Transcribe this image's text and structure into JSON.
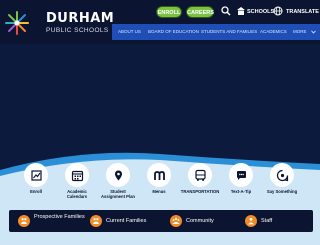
{
  "brand": {
    "name": "DURHAM",
    "subtitle": "PUBLIC SCHOOLS"
  },
  "utility": {
    "enroll_label": "ENROLL",
    "careers_label": "CAREERS",
    "schools_label": "SCHOOLS",
    "translate_label": "TRANSLATE"
  },
  "nav": {
    "items": [
      "ABOUT US",
      "BOARD OF EDUCATION",
      "STUDENTS AND FAMILIES",
      "ACADEMICS",
      "MORE"
    ]
  },
  "quick_links": [
    {
      "label": "Enroll",
      "icon": "enroll-icon"
    },
    {
      "label": "Academic Calendars",
      "icon": "calendar-icon"
    },
    {
      "label": "Student Assignment Plan",
      "icon": "map-pin-icon"
    },
    {
      "label": "Menus",
      "icon": "menus-icon"
    },
    {
      "label": "TRANSPORTATION",
      "icon": "bus-icon"
    },
    {
      "label": "Text-A-Tip",
      "icon": "chat-icon"
    },
    {
      "label": "Say Something",
      "icon": "megaphone-icon"
    }
  ],
  "audiences": [
    {
      "label": "Prospective Families",
      "icon": "family-icon"
    },
    {
      "label": "Current Families",
      "icon": "family-icon"
    },
    {
      "label": "Community",
      "icon": "community-icon"
    },
    {
      "label": "Staff",
      "icon": "staff-icon"
    }
  ],
  "colors": {
    "navy": "#0b1430",
    "hero": "#0c1a3e",
    "nav_blue": "#1e4eb6",
    "wave_blue": "#2a8fd6",
    "light_band": "#cfe6f6",
    "green": "#7cc142",
    "orange": "#f28c28"
  }
}
